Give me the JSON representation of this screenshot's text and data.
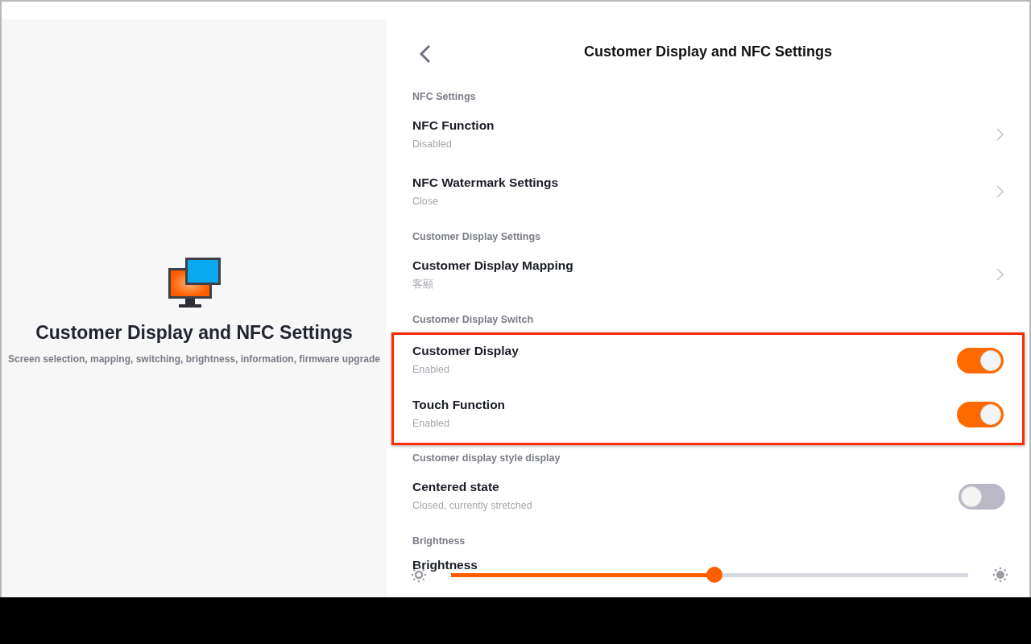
{
  "intro": {
    "title": "Customer Display and NFC Settings",
    "subtitle": "Screen selection, mapping, switching, brightness, information, firmware upgrade"
  },
  "header": {
    "title": "Customer Display and NFC Settings"
  },
  "sections": [
    {
      "heading": "NFC Settings",
      "highlighted": false,
      "items": [
        {
          "kind": "nav",
          "title": "NFC Function",
          "value": "Disabled"
        },
        {
          "kind": "nav",
          "title": "NFC Watermark Settings",
          "value": "Close"
        }
      ]
    },
    {
      "heading": "Customer Display Settings",
      "highlighted": false,
      "items": [
        {
          "kind": "nav",
          "title": "Customer Display Mapping",
          "value": "客顯"
        }
      ]
    },
    {
      "heading": "Customer Display Switch",
      "highlighted": true,
      "items": [
        {
          "kind": "switch",
          "title": "Customer Display",
          "value": "Enabled",
          "on": true
        },
        {
          "kind": "switch",
          "title": "Touch Function",
          "value": "Enabled",
          "on": true
        }
      ]
    },
    {
      "heading": "Customer display style display",
      "highlighted": false,
      "items": [
        {
          "kind": "switch",
          "title": "Centered state",
          "value": "Closed, currently stretched",
          "on": false
        }
      ]
    },
    {
      "heading": "Brightness",
      "highlighted": false,
      "items": [
        {
          "kind": "slider",
          "title": "Brightness",
          "level": 0.51
        }
      ]
    }
  ]
}
